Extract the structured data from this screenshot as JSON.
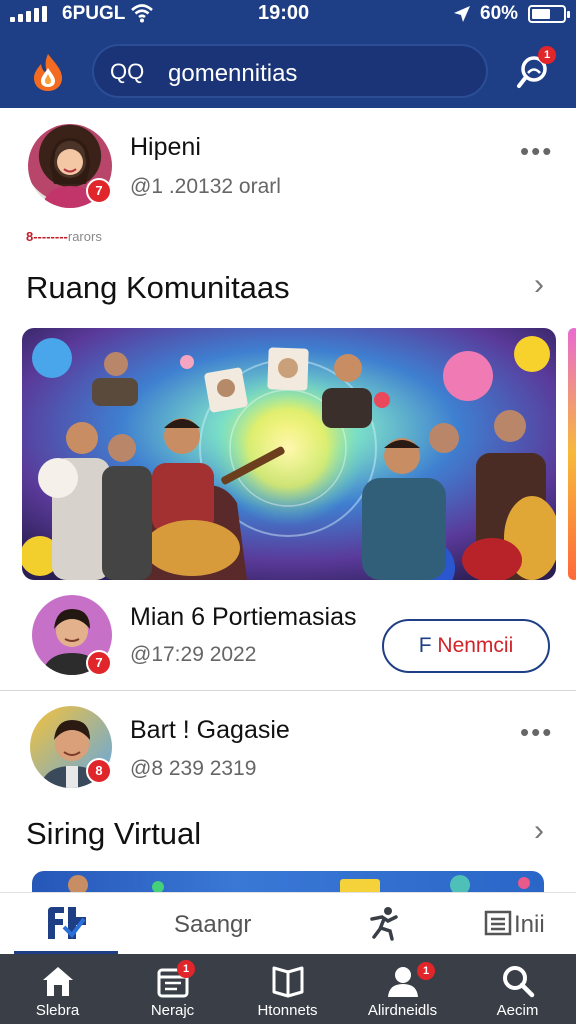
{
  "status_bar": {
    "carrier": "6PUGL",
    "time": "19:00",
    "battery": "60%",
    "battery_level": 0.6
  },
  "header": {
    "search_icon": "QQ",
    "search_text": "gomennitias",
    "notification_count": "1"
  },
  "posts": [
    {
      "name": "Hipeni",
      "handle": "@1 .20132 orarl",
      "badge": "7"
    },
    {
      "name": "Mian 6 Portiemasias",
      "handle": "@17:29 2022",
      "badge": "7"
    },
    {
      "name": "Bart ! Gagasie",
      "handle": "@8 239 2319",
      "badge": "8"
    }
  ],
  "tiny_caption": {
    "red": "8--------",
    "grey": "rarors"
  },
  "sections": {
    "community": "Ruang Komunitaas",
    "virtual": "Siring Virtual"
  },
  "join_button": {
    "left": "F",
    "right": "Nenmcii"
  },
  "tabs": [
    {
      "label": "",
      "icon": "feed-icon"
    },
    {
      "label": "Saangr",
      "icon": ""
    },
    {
      "label": "",
      "icon": "activity-icon"
    },
    {
      "label": "Inii",
      "icon": "list-icon"
    }
  ],
  "bottom_nav": [
    {
      "label": "Slebra",
      "icon": "home-icon",
      "badge": ""
    },
    {
      "label": "Nerajc",
      "icon": "calendar-icon",
      "badge": "1"
    },
    {
      "label": "Htonnets",
      "icon": "book-icon",
      "badge": ""
    },
    {
      "label": "Alirdneidls",
      "icon": "person-icon",
      "badge": "1"
    },
    {
      "label": "Aecim",
      "icon": "search-icon",
      "badge": ""
    }
  ],
  "colors": {
    "brand": "#1e3f86",
    "badge": "#e0252b",
    "bottom_bar": "#3a3f47"
  }
}
